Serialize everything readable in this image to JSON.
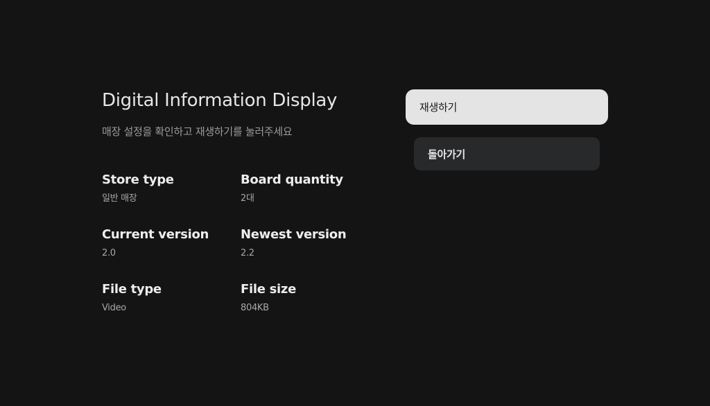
{
  "header": {
    "title": "Digital Information Display",
    "subtitle": "매장 설정을 확인하고 재생하기를 눌러주세요"
  },
  "info": {
    "store_type": {
      "label": "Store type",
      "value": "일반 매장"
    },
    "board_quantity": {
      "label": "Board quantity",
      "value": "2대"
    },
    "current_version": {
      "label": "Current version",
      "value": "2.0"
    },
    "newest_version": {
      "label": "Newest version",
      "value": "2.2"
    },
    "file_type": {
      "label": "File type",
      "value": "Video"
    },
    "file_size": {
      "label": "File size",
      "value": "804KB"
    }
  },
  "actions": {
    "play_label": "재생하기",
    "back_label": "돌아가기"
  },
  "colors": {
    "background": "#141414",
    "primary_button": "#e4e4e4",
    "secondary_button": "#28292b"
  }
}
